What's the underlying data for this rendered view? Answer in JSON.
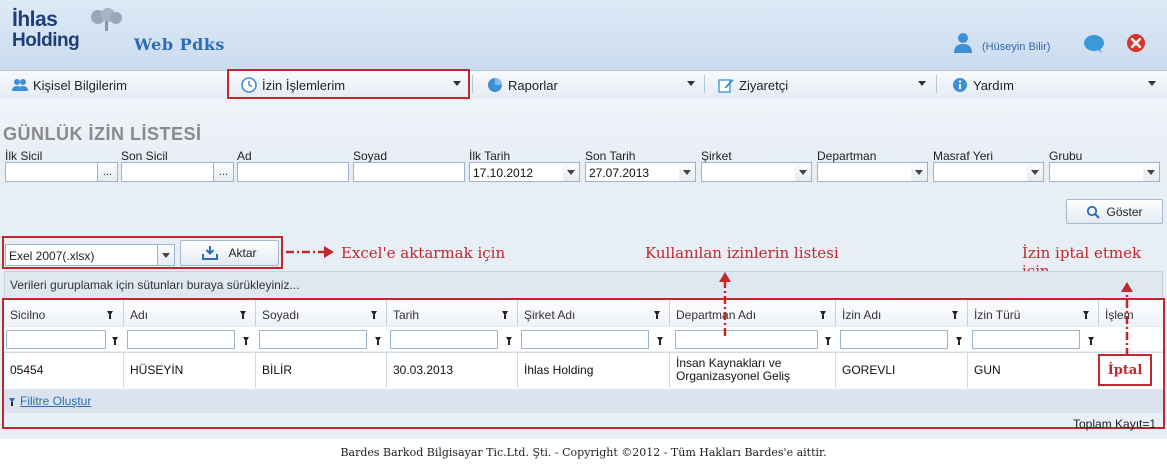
{
  "header": {
    "logo_line1": "İhlas",
    "logo_line2": "Holding",
    "app_title": "Web Pdks",
    "user_name": "(Hüseyin Bilir)"
  },
  "menu": [
    {
      "label": "Kişisel Bilgilerim",
      "icon": "users-icon"
    },
    {
      "label": "İzin İşlemlerim",
      "icon": "clock-icon"
    },
    {
      "label": "Raporlar",
      "icon": "pie-chart-icon"
    },
    {
      "label": "Ziyaretçi",
      "icon": "edit-icon"
    },
    {
      "label": "Yardım",
      "icon": "info-icon"
    }
  ],
  "page_title": "GÜNLÜK İZİN LİSTESİ",
  "filters": {
    "labels": [
      "İlk Sicil",
      "Son Sicil",
      "Ad",
      "Soyad",
      "İlk Tarih",
      "Son Tarih",
      "Şirket",
      "Departman",
      "Masraf Yeri",
      "Grubu"
    ],
    "ilk_tarih": "17.10.2012",
    "son_tarih": "27.07.2013",
    "ellipsis": "..."
  },
  "buttons": {
    "show": "Göster",
    "export": "Aktar"
  },
  "export_format": "Exel 2007(.xlsx)",
  "annotations": {
    "export_note": "Excel'e aktarmak için",
    "list_note": "Kullanılan izinlerin listesi",
    "cancel_note": "İzin iptal etmek için"
  },
  "group_hint": "Verileri guruplamak için sütunları buraya sürükleyiniz...",
  "grid": {
    "columns": [
      "Sicilno",
      "Adı",
      "Soyadı",
      "Tarih",
      "Şirket Adı",
      "Departman Adı",
      "İzin Adı",
      "İzin Türü",
      "İşlem"
    ],
    "rows": [
      {
        "sicilno": "05454",
        "adi": "HÜSEYİN",
        "soyadi": "BİLİR",
        "tarih": "30.03.2013",
        "sirket": "İhlas Holding",
        "departman": "İnsan Kaynakları ve Organizasyonel Geliş",
        "izin_adi": "GOREVLI",
        "izin_turu": "GUN",
        "islem": "İptal"
      }
    ],
    "filter_link": "Filitre Oluştur",
    "total": "Toplam Kayıt=1"
  },
  "colors": {
    "accent_red": "#c0282e",
    "link_blue": "#2b6db6",
    "brand_navy": "#1e3f7a"
  },
  "copyright": "Bardes Barkod Bilgisayar Tic.Ltd. Şti. - Copyright ©2012 - Tüm Hakları Bardes'e aittir."
}
